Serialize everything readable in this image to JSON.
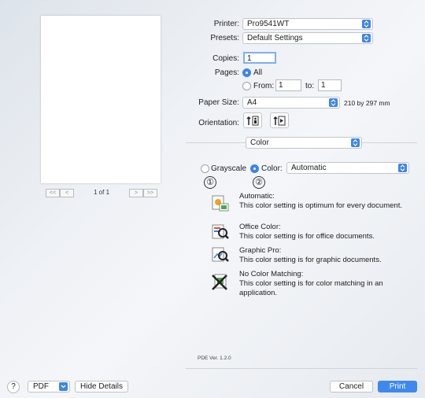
{
  "preview": {
    "first_btn": "<<",
    "prev_btn": "<",
    "page_label": "1 of 1",
    "next_btn": ">",
    "last_btn": ">>"
  },
  "printer": {
    "label": "Printer:",
    "value": "Pro9541WT"
  },
  "presets": {
    "label": "Presets:",
    "value": "Default Settings"
  },
  "copies": {
    "label": "Copies:",
    "value": "1"
  },
  "pages": {
    "label": "Pages:",
    "all": "All",
    "from": "From:",
    "from_value": "1",
    "to": "to:",
    "to_value": "1"
  },
  "paper_size": {
    "label": "Paper Size:",
    "value": "A4",
    "dims": "210 by 297 mm"
  },
  "orientation": {
    "label": "Orientation:"
  },
  "panel": {
    "value": "Color"
  },
  "color_mode": {
    "grayscale": "Grayscale",
    "color": "Color:",
    "color_value": "Automatic",
    "callout1": "①",
    "callout2": "②"
  },
  "options": [
    {
      "title": "Automatic:",
      "desc": "This color setting is optimum for every document."
    },
    {
      "title": "Office Color:",
      "desc": "This color setting is for office documents."
    },
    {
      "title": "Graphic Pro:",
      "desc": "This color setting is for graphic documents."
    },
    {
      "title": "No Color Matching:",
      "desc": "This color setting is for color matching in an application."
    }
  ],
  "pde_version": "PDE Ver.  1.2.0",
  "footer": {
    "help": "?",
    "pdf": "PDF",
    "hide_details": "Hide Details",
    "cancel": "Cancel",
    "print": "Print"
  },
  "colors": {
    "accent": "#3f89ee"
  }
}
